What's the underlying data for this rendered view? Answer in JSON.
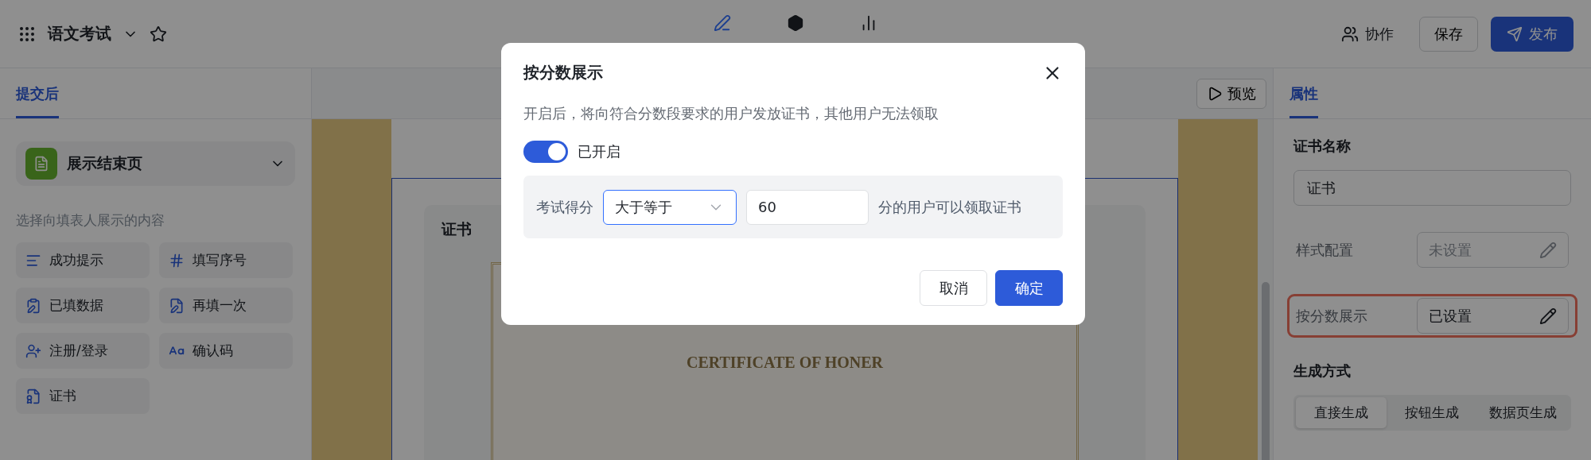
{
  "header": {
    "title": "语文考试",
    "nav": [
      {
        "selected": true
      },
      {
        "selected": false
      },
      {
        "selected": false
      }
    ],
    "collab": "协作",
    "save": "保存",
    "publish": "发布"
  },
  "left_panel": {
    "tabs": [
      {
        "label": "提交后",
        "selected": true
      }
    ],
    "page_select": "展示结束页",
    "hint": "选择向填表人展示的内容",
    "items": [
      {
        "label": "成功提示"
      },
      {
        "label": "填写序号"
      },
      {
        "label": "已填数据"
      },
      {
        "label": "再填一次"
      },
      {
        "label": "注册/登录"
      },
      {
        "label": "确认码"
      },
      {
        "label": "证书"
      }
    ]
  },
  "canvas": {
    "preview": "预览",
    "card_title": "证书",
    "certificate_subtitle": "CERTIFICATE OF HONER"
  },
  "properties": {
    "tabs": [
      {
        "label": "属性",
        "selected": true
      }
    ],
    "name_label": "证书名称",
    "name_value": "证书",
    "rows": [
      {
        "label": "样式配置",
        "value": "未设置",
        "set": false,
        "highlighted": false
      },
      {
        "label": "按分数展示",
        "value": "已设置",
        "set": true,
        "highlighted": true
      }
    ],
    "mode_label": "生成方式",
    "modes": [
      {
        "label": "直接生成",
        "selected": true
      },
      {
        "label": "按钮生成",
        "selected": false
      },
      {
        "label": "数据页生成",
        "selected": false
      }
    ]
  },
  "dialog": {
    "title": "按分数展示",
    "description": "开启后，将向符合分数段要求的用户发放证书，其他用户无法领取",
    "toggle": {
      "on": true,
      "label": "已开启"
    },
    "condition": {
      "label": "考试得分",
      "operator": "大于等于",
      "score": "60",
      "suffix": "分的用户可以领取证书"
    },
    "buttons": [
      {
        "label": "取消",
        "kind": "secondary"
      },
      {
        "label": "确定",
        "kind": "primary"
      }
    ]
  }
}
